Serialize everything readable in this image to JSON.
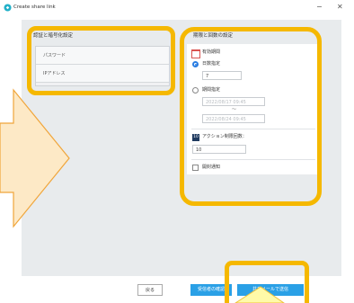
{
  "window": {
    "title": "Create share link",
    "minimize_glyph": "−",
    "close_glyph": "✕"
  },
  "left_section": {
    "title": "認証と暗号化設定",
    "items": [
      "パスワード",
      "IPアドレス"
    ]
  },
  "right_section": {
    "title": "期限と回数の設定",
    "expiry_label": "有効期間",
    "option_days_label": "日数指定",
    "days_value": "7",
    "option_date_label": "期間指定",
    "date_from_placeholder": "2022/08/17 09:45",
    "date_separator": "〜",
    "date_to_placeholder": "2022/08/24 09:45",
    "action_badge": "10",
    "action_limit_label": "アクション制限回数：",
    "action_limit_value": "10",
    "notify_label": "開封通知"
  },
  "footer": {
    "back_label": "戻る",
    "confirm_label": "受信者の確認",
    "send_label": "共有メールで送信"
  },
  "colors": {
    "accent_highlight": "#f5b800",
    "arrow_fill": "#fde9c6",
    "callout_fill": "#fffaa8",
    "primary_button": "#2aa0e6"
  }
}
